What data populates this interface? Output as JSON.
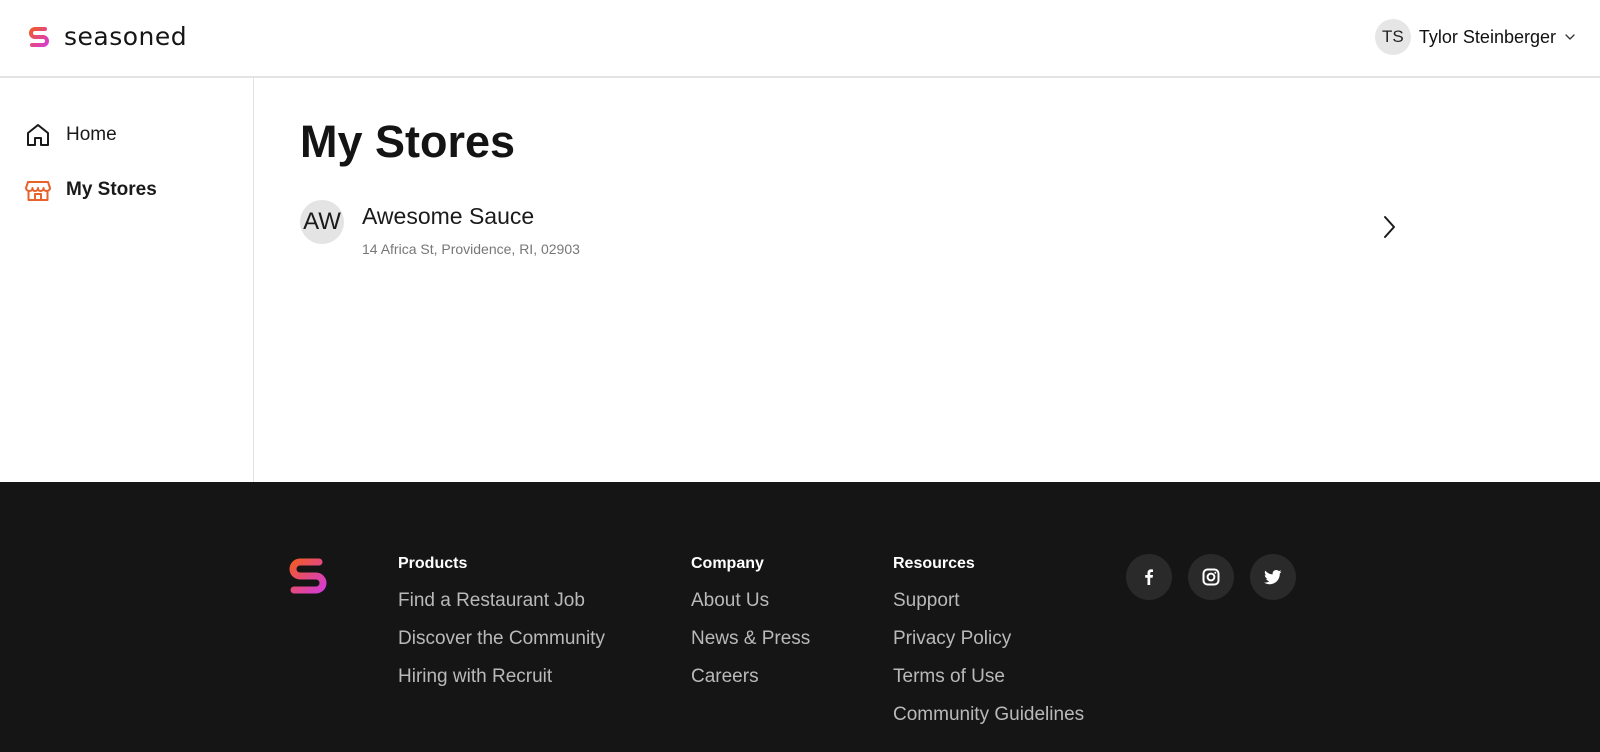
{
  "header": {
    "brand_name": "seasoned",
    "user": {
      "initials": "TS",
      "name": "Tylor Steinberger"
    }
  },
  "sidebar": {
    "items": [
      {
        "label": "Home",
        "icon": "home-icon",
        "active": false
      },
      {
        "label": "My Stores",
        "icon": "store-icon",
        "active": true
      }
    ]
  },
  "main": {
    "title": "My Stores",
    "stores": [
      {
        "initials": "AW",
        "name": "Awesome Sauce",
        "address": "14 Africa St, Providence, RI, 02903"
      }
    ]
  },
  "footer": {
    "columns": [
      {
        "heading": "Products",
        "links": [
          "Find a Restaurant Job",
          "Discover the Community",
          "Hiring with Recruit"
        ]
      },
      {
        "heading": "Company",
        "links": [
          "About Us",
          "News & Press",
          "Careers"
        ]
      },
      {
        "heading": "Resources",
        "links": [
          "Support",
          "Privacy Policy",
          "Terms of Use",
          "Community Guidelines"
        ]
      }
    ],
    "socials": [
      "facebook-icon",
      "instagram-icon",
      "twitter-icon"
    ]
  },
  "colors": {
    "accent_orange": "#e8622b",
    "brand_gradient_start": "#f0592a",
    "brand_gradient_end": "#d63bd2",
    "footer_bg": "#151515"
  }
}
